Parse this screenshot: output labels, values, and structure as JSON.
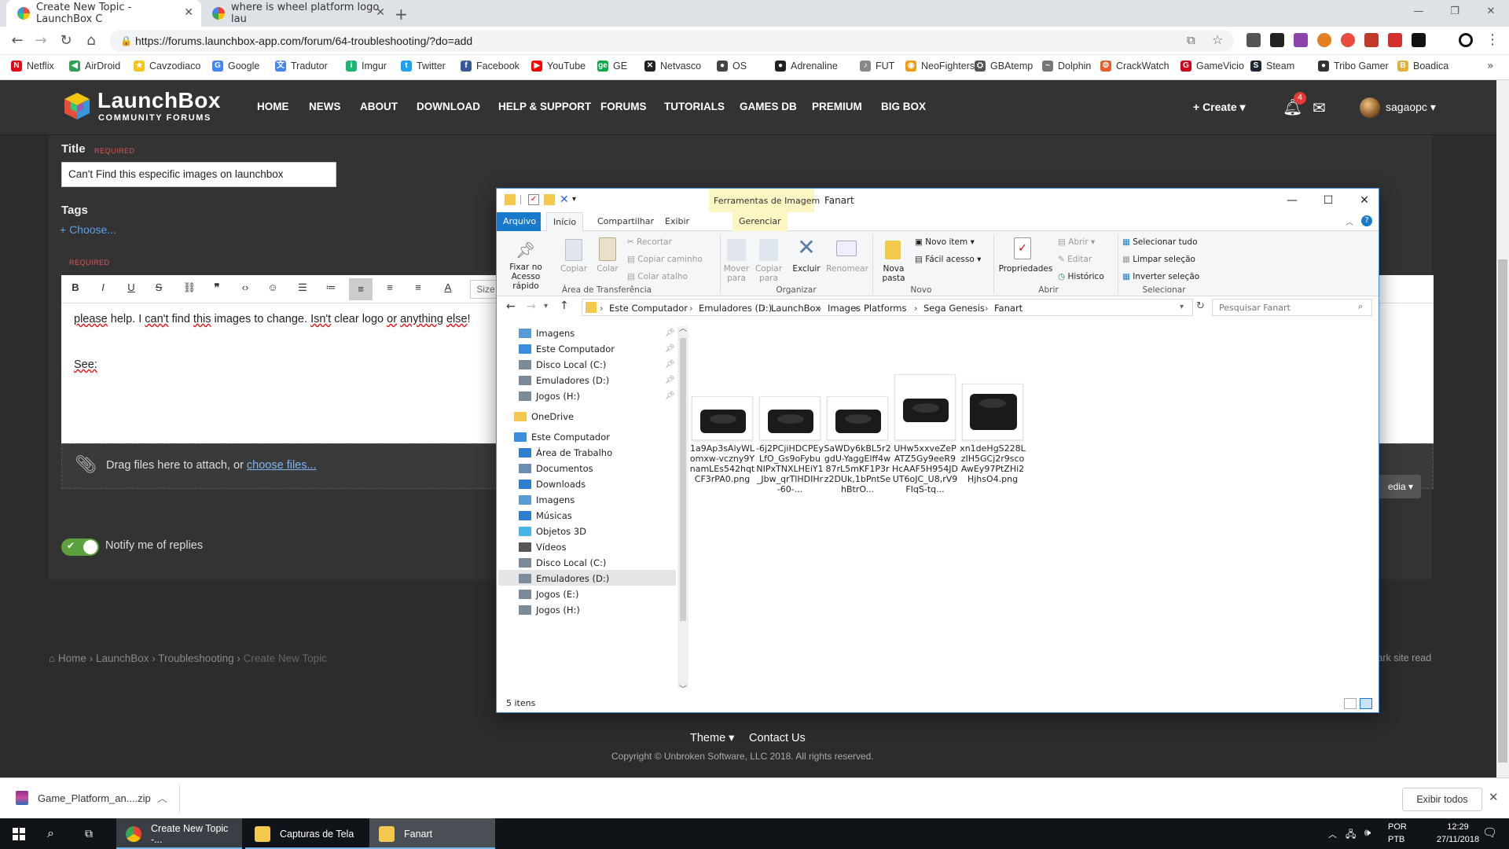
{
  "browser": {
    "tabs": [
      {
        "title": "Create New Topic - LaunchBox C",
        "favicon_color": "#e74c3c"
      },
      {
        "title": "where is wheel platform logo lau",
        "favicon_color": "#4285f4"
      }
    ],
    "url": "https://forums.launchbox-app.com/forum/64-troubleshooting/?do=add",
    "bookmarks": [
      {
        "label": "Netflix",
        "color": "#e50914",
        "glyph": "N"
      },
      {
        "label": "AirDroid",
        "color": "#2ea44f",
        "glyph": "◀"
      },
      {
        "label": "Cavzodiaco",
        "color": "#f5c518",
        "glyph": "★"
      },
      {
        "label": "Google",
        "color": "#4285f4",
        "glyph": "G"
      },
      {
        "label": "Tradutor",
        "color": "#4285f4",
        "glyph": "文"
      },
      {
        "label": "Imgur",
        "color": "#1bb76e",
        "glyph": "i"
      },
      {
        "label": "Twitter",
        "color": "#1da1f2",
        "glyph": "t"
      },
      {
        "label": "Facebook",
        "color": "#3b5998",
        "glyph": "f"
      },
      {
        "label": "YouTube",
        "color": "#ff0000",
        "glyph": "▶"
      },
      {
        "label": "GE",
        "color": "#06aa48",
        "glyph": "ge"
      },
      {
        "label": "Netvasco",
        "color": "#222222",
        "glyph": "✕"
      },
      {
        "label": "OS",
        "color": "#444444",
        "glyph": "●"
      },
      {
        "label": "Adrenaline",
        "color": "#222222",
        "glyph": "●"
      },
      {
        "label": "FUT",
        "color": "#888888",
        "glyph": "♪"
      },
      {
        "label": "NeoFighters",
        "color": "#f39c12",
        "glyph": "◉"
      },
      {
        "label": "GBAtemp",
        "color": "#555555",
        "glyph": "⛭"
      },
      {
        "label": "Dolphin",
        "color": "#777777",
        "glyph": "~"
      },
      {
        "label": "CrackWatch",
        "color": "#e85d2a",
        "glyph": "⚙"
      },
      {
        "label": "GameVicio",
        "color": "#d0021b",
        "glyph": "G"
      },
      {
        "label": "Steam",
        "color": "#1b2838",
        "glyph": "S"
      },
      {
        "label": "Tribo Gamer",
        "color": "#333333",
        "glyph": "●"
      },
      {
        "label": "Boadica",
        "color": "#e2b13c",
        "glyph": "B"
      }
    ]
  },
  "site": {
    "brand": "LaunchBox",
    "brand_sub": "COMMUNITY FORUMS",
    "nav": [
      "HOME",
      "NEWS",
      "ABOUT",
      "DOWNLOAD",
      "HELP & SUPPORT",
      "FORUMS",
      "TUTORIALS",
      "GAMES DB",
      "PREMIUM",
      "BIG BOX"
    ],
    "create_label": "+ Create ▾",
    "notifications_count": "4",
    "username": "sagaopc ▾"
  },
  "form": {
    "title_label": "Title",
    "required": "REQUIRED",
    "title_value": "Can't Find this especific images on launchbox",
    "tags_label": "Tags",
    "tags_choose": "+ Choose...",
    "size_label": "Size",
    "body_line1_parts": [
      "please",
      " help. I ",
      "can't",
      " find ",
      "this",
      " images to change. ",
      "Isn't",
      " clear logo ",
      "or",
      " ",
      "anything",
      " ",
      "else",
      "!"
    ],
    "body_line2": "See:",
    "attach_text": "Drag files here to attach, or ",
    "attach_link": "choose files...",
    "media_label": "edia ▾",
    "notify_label": "Notify me of replies"
  },
  "footer": {
    "breadcrumb": [
      "Home",
      "LaunchBox",
      "Troubleshooting",
      "Create New Topic"
    ],
    "mark_read": "Mark site read",
    "theme": "Theme ▾",
    "contact": "Contact Us",
    "copyright": "Copyright © Unbroken Software, LLC 2018. All rights reserved."
  },
  "explorer": {
    "context_tab": "Ferramentas de Imagem",
    "window_title": "Fanart",
    "tabs": [
      "Arquivo",
      "Início",
      "Compartilhar",
      "Exibir"
    ],
    "context_sub_tab": "Gerenciar",
    "ribbon": {
      "pin_label": "Fixar no Acesso rápido",
      "copy_label": "Copiar",
      "paste_label": "Colar",
      "cut_label": "Recortar",
      "copy_path_label": "Copiar caminho",
      "paste_shortcut_label": "Colar atalho",
      "clipboard_group": "Área de Transferência",
      "move_label": "Mover para",
      "copyto_label": "Copiar para",
      "delete_label": "Excluir",
      "rename_label": "Renomear",
      "organize_group": "Organizar",
      "newfolder_label": "Nova pasta",
      "newitem_label": "Novo item ▾",
      "easyaccess_label": "Fácil acesso ▾",
      "new_group": "Novo",
      "properties_label": "Propriedades",
      "open_label": "Abrir ▾",
      "edit_label": "Editar",
      "history_label": "Histórico",
      "open_group": "Abrir",
      "selectall_label": "Selecionar tudo",
      "selectnone_label": "Limpar seleção",
      "invert_label": "Inverter seleção",
      "select_group": "Selecionar"
    },
    "path": [
      "Este Computador",
      "Emuladores (D:)",
      "LaunchBox",
      "Images",
      "Platforms",
      "Sega Genesis",
      "Fanart"
    ],
    "search_placeholder": "Pesquisar Fanart",
    "nav_items": [
      {
        "label": "Imagens",
        "indent": 1,
        "pinned": true,
        "color": "#5b9bd5"
      },
      {
        "label": "Este Computador",
        "indent": 1,
        "pinned": true,
        "color": "#3c8dde"
      },
      {
        "label": "Disco Local (C:)",
        "indent": 1,
        "pinned": true,
        "color": "#7a8a99"
      },
      {
        "label": "Emuladores (D:)",
        "indent": 1,
        "pinned": true,
        "color": "#7a8a99"
      },
      {
        "label": "Jogos (H:)",
        "indent": 1,
        "pinned": true,
        "color": "#7a8a99"
      },
      {
        "label": "OneDrive",
        "indent": 0,
        "pinned": false,
        "color": "#f2c94c"
      },
      {
        "label": "Este Computador",
        "indent": 0,
        "pinned": false,
        "color": "#3c8dde"
      },
      {
        "label": "Área de Trabalho",
        "indent": 1,
        "pinned": false,
        "color": "#2f7fd1"
      },
      {
        "label": "Documentos",
        "indent": 1,
        "pinned": false,
        "color": "#6b8db5"
      },
      {
        "label": "Downloads",
        "indent": 1,
        "pinned": false,
        "color": "#2f7fd1"
      },
      {
        "label": "Imagens",
        "indent": 1,
        "pinned": false,
        "color": "#5b9bd5"
      },
      {
        "label": "Músicas",
        "indent": 1,
        "pinned": false,
        "color": "#2f7fd1"
      },
      {
        "label": "Objetos 3D",
        "indent": 1,
        "pinned": false,
        "color": "#46b5e5"
      },
      {
        "label": "Vídeos",
        "indent": 1,
        "pinned": false,
        "color": "#555555"
      },
      {
        "label": "Disco Local (C:)",
        "indent": 1,
        "pinned": false,
        "color": "#7a8a99"
      },
      {
        "label": "Emuladores (D:)",
        "indent": 1,
        "pinned": false,
        "color": "#7a8a99",
        "selected": true
      },
      {
        "label": "Jogos (E:)",
        "indent": 1,
        "pinned": false,
        "color": "#7a8a99"
      },
      {
        "label": "Jogos (H:)",
        "indent": 1,
        "pinned": false,
        "color": "#7a8a99"
      }
    ],
    "files": [
      "1a9Ap3sAlyWLomxw-vczny9YnamLEs542hqtCF3rPA0.png",
      "-6j2PCjiHDCPEyLfO_Gs9oFybuNIPxTNXLHEiY1_Jbw_qrTlHDIHr-60-...",
      "SaWDy6kBL5r2gdU-YaggElff4w87rL5mKF1P3rz2DUk,1bPntSehBtrO...",
      "UHw5xxveZePATZ5Gy9eeR9HcAAF5H954JDUT6oJC_U8,rV9FIqS-tq...",
      "xn1deHgS228LzIH5GCj2r9scoAwEy97PtZHi2HjhsO4.png"
    ],
    "status": "5 itens"
  },
  "download": {
    "filename": "Game_Platform_an....zip",
    "show_all": "Exibir todos"
  },
  "taskbar": {
    "apps": [
      {
        "label": "Create New Topic -...",
        "color": "#e74c3c"
      },
      {
        "label": "Capturas de Tela",
        "color": "#f2c94c"
      },
      {
        "label": "Fanart",
        "color": "#f2c94c"
      }
    ],
    "lang": "POR",
    "layout": "PTB",
    "time": "12:29",
    "date": "27/11/2018"
  }
}
